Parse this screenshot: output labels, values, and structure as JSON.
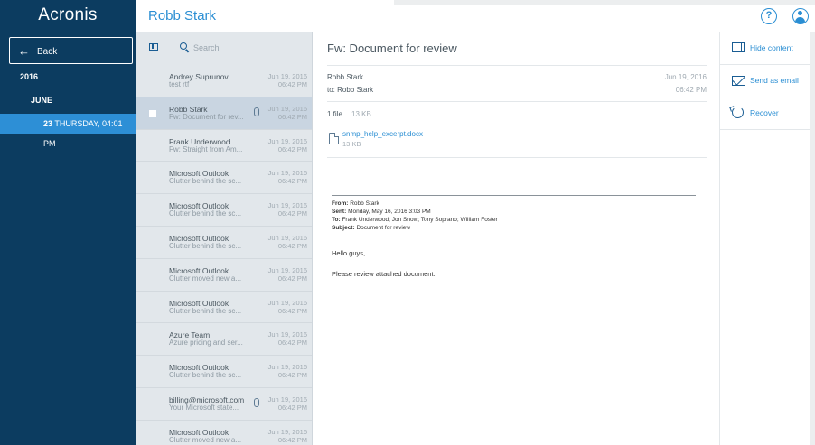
{
  "app": {
    "brand": "Acronis",
    "user_title": "Robb Stark"
  },
  "nav": {
    "back_label": "Back",
    "year": "2016",
    "month": "JUNE",
    "day_num": "23",
    "day_text": "THURSDAY, 04:01 PM"
  },
  "list": {
    "search_placeholder": "Search",
    "rows": [
      {
        "sender": "Andrey Suprunov",
        "preview": "test rtf",
        "date": "Jun 19, 2016",
        "time": "06:42 PM",
        "attachment": false,
        "selected": false
      },
      {
        "sender": "Robb Stark",
        "preview": "Fw: Document for rev...",
        "date": "Jun 19, 2016",
        "time": "06:42 PM",
        "attachment": true,
        "selected": true
      },
      {
        "sender": "Frank Underwood",
        "preview": "Fw: Straight from Am...",
        "date": "Jun 19, 2016",
        "time": "06:42 PM",
        "attachment": false,
        "selected": false
      },
      {
        "sender": "Microsoft Outlook",
        "preview": "Clutter behind the sc...",
        "date": "Jun 19, 2016",
        "time": "06:42 PM",
        "attachment": false,
        "selected": false
      },
      {
        "sender": "Microsoft Outlook",
        "preview": "Clutter behind the sc...",
        "date": "Jun 19, 2016",
        "time": "06:42 PM",
        "attachment": false,
        "selected": false
      },
      {
        "sender": "Microsoft Outlook",
        "preview": "Clutter behind the sc...",
        "date": "Jun 19, 2016",
        "time": "06:42 PM",
        "attachment": false,
        "selected": false
      },
      {
        "sender": "Microsoft Outlook",
        "preview": "Clutter moved new a...",
        "date": "Jun 19, 2016",
        "time": "06:42 PM",
        "attachment": false,
        "selected": false
      },
      {
        "sender": "Microsoft Outlook",
        "preview": "Clutter behind the sc...",
        "date": "Jun 19, 2016",
        "time": "06:42 PM",
        "attachment": false,
        "selected": false
      },
      {
        "sender": "Azure Team",
        "preview": "Azure pricing and ser...",
        "date": "Jun 19, 2016",
        "time": "06:42 PM",
        "attachment": false,
        "selected": false
      },
      {
        "sender": "Microsoft Outlook",
        "preview": "Clutter behind the sc...",
        "date": "Jun 19, 2016",
        "time": "06:42 PM",
        "attachment": false,
        "selected": false
      },
      {
        "sender": "billing@microsoft.com",
        "preview": "Your Microsoft state...",
        "date": "Jun 19, 2016",
        "time": "06:42 PM",
        "attachment": true,
        "selected": false
      },
      {
        "sender": "Microsoft Outlook",
        "preview": "Clutter moved new a...",
        "date": "Jun 19, 2016",
        "time": "06:42 PM",
        "attachment": false,
        "selected": false
      }
    ]
  },
  "message": {
    "subject": "Fw: Document for review",
    "from": "Robb Stark",
    "to": "to: Robb Stark",
    "date": "Jun 19, 2016",
    "time": "06:42 PM",
    "file_count": "1 file",
    "file_total_size": "13 KB",
    "attachment_name": "snmp_help_excerpt.docx",
    "attachment_size": "13 KB",
    "fwd_from_label": "From:",
    "fwd_from": "Robb Stark",
    "fwd_sent_label": "Sent:",
    "fwd_sent": "Monday, May 16, 2016 3:03 PM",
    "fwd_to_label": "To:",
    "fwd_to": "Frank Underwood; Jon Snow; Tony Soprano; William Foster",
    "fwd_subject_label": "Subject:",
    "fwd_subject": "Document for review",
    "greeting": "Hello guys,",
    "body": "Please review attached document."
  },
  "actions": {
    "hide_content": "Hide content",
    "send_as_email": "Send as email",
    "recover": "Recover"
  },
  "colors": {
    "nav_bg": "#0c3c60",
    "accent": "#2a8ed3",
    "selected_day": "#2d8fd6",
    "list_bg": "#e2e7eb"
  },
  "icons": {
    "help": "?"
  }
}
